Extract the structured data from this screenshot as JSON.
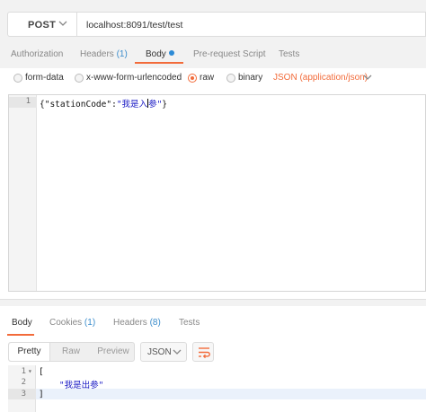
{
  "request": {
    "method": "POST",
    "url": "localhost:8091/test/test"
  },
  "request_tabs": [
    {
      "label": "Authorization",
      "count": "",
      "active": false
    },
    {
      "label": "Headers",
      "count": "(1)",
      "active": false
    },
    {
      "label": "Body",
      "count": "",
      "active": true,
      "indicator": "modified-dot"
    },
    {
      "label": "Pre-request Script",
      "count": "",
      "active": false
    },
    {
      "label": "Tests",
      "count": "",
      "active": false
    }
  ],
  "body_types": [
    {
      "label": "form-data",
      "selected": false
    },
    {
      "label": "x-www-form-urlencoded",
      "selected": false
    },
    {
      "label": "raw",
      "selected": true
    },
    {
      "label": "binary",
      "selected": false
    }
  ],
  "content_type": "JSON (application/json)",
  "request_editor": {
    "line_numbers": [
      "1"
    ],
    "lines": [
      {
        "punct_open": "{",
        "key": "\"stationCode\"",
        "colon": ":",
        "value_before_caret": "\"我是入",
        "value_after_caret": "参\"",
        "punct_close": "}"
      }
    ]
  },
  "response_tabs": [
    {
      "label": "Body",
      "count": "",
      "active": true
    },
    {
      "label": "Cookies",
      "count": "(1)",
      "active": false
    },
    {
      "label": "Headers",
      "count": "(8)",
      "active": false
    },
    {
      "label": "Tests",
      "count": "",
      "active": false
    }
  ],
  "response_view_modes": [
    "Pretty",
    "Raw",
    "Preview"
  ],
  "response_view_selected": "Pretty",
  "response_format": "JSON",
  "response_editor": {
    "line_numbers": [
      "1",
      "2",
      "3"
    ],
    "fold_marker": "▾",
    "lines": [
      "[",
      "    \"我是出参\"",
      "]"
    ]
  },
  "colors": {
    "accent": "#f26b3a",
    "count": "#3c8dcc",
    "dot": "#2d8bd6",
    "string": "#1a1ac4"
  },
  "icons": [
    "chevron-down-icon",
    "wrap-lines-icon",
    "fold-arrow-icon"
  ]
}
